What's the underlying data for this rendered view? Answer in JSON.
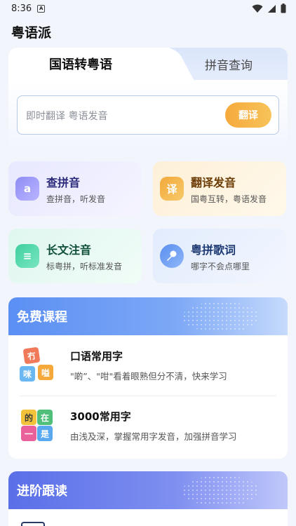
{
  "status_bar": {
    "time": "8:36",
    "badge": "A",
    "wifi_icon": "wifi-icon",
    "signal_icon": "signal-icon",
    "battery_icon": "battery-icon"
  },
  "app": {
    "title": "粤语派"
  },
  "translate": {
    "tab_active": "国语转粤语",
    "tab_inactive": "拼音查询",
    "placeholder": "即时翻译 粤语发音",
    "button": "翻译"
  },
  "features": [
    {
      "title": "查拼音",
      "subtitle": "查拼音，听发音",
      "icon": "a",
      "icon_name": "alphabet-icon"
    },
    {
      "title": "翻译发音",
      "subtitle": "国粤互转，粤语发音",
      "icon": "译",
      "icon_name": "translate-icon"
    },
    {
      "title": "长文注音",
      "subtitle": "标粤拼，听标准发音",
      "icon": "≡",
      "icon_name": "document-icon"
    },
    {
      "title": "粤拼歌词",
      "subtitle": "哪字不会点哪里",
      "icon": "🎤",
      "icon_name": "microphone-icon"
    }
  ],
  "free_courses": {
    "header": "免费课程",
    "items": [
      {
        "title": "口语常用字",
        "subtitle": "\"啲”、\"咁\"看着眼熟但分不清，快来学习",
        "thumb_chars": [
          "冇",
          "咪",
          "嗌"
        ]
      },
      {
        "title": "3000常用字",
        "subtitle": "由浅及深，掌握常用字发音，加强拼音学习",
        "thumb_chars": [
          "的",
          "在",
          "一",
          "是"
        ]
      }
    ]
  },
  "advanced": {
    "header": "进阶跟读"
  },
  "colors": {
    "accent_orange": "#f6a93b",
    "accent_blue": "#5b8ff3"
  }
}
